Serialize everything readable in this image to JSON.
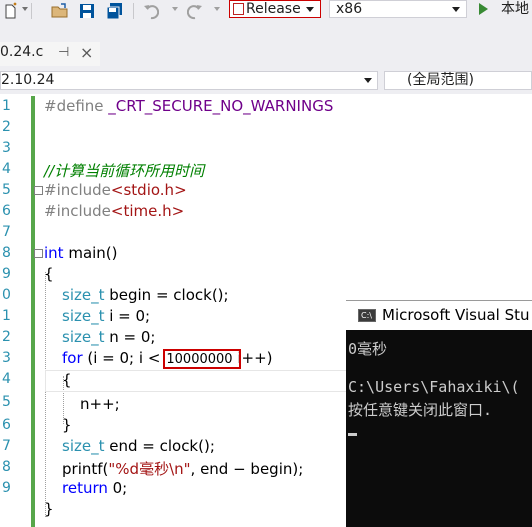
{
  "toolbar": {
    "configuration": "Release",
    "platform": "x86",
    "run_label": "本地"
  },
  "tab": {
    "title": "0.24.c",
    "pin": "⊣",
    "close": "×"
  },
  "navbar": {
    "left_scope": "2.10.24",
    "right_scope": "(全局范围)"
  },
  "editor": {
    "line_numbers": [
      "1",
      "2",
      "3",
      "4",
      "5",
      "6",
      "7",
      "8",
      "9",
      "0",
      "1",
      "2",
      "3",
      "4",
      "5",
      "6",
      "7",
      "8",
      "9"
    ],
    "l1_pp": "#define",
    "l1_macro": " _CRT_SECURE_NO_WARNINGS",
    "l4_comment": "//计算当前循环所用时间",
    "l5_pp": "#include",
    "l5_hdr": "<stdio.h>",
    "l6_pp": "#include",
    "l6_hdr": "<time.h>",
    "l8_kw": "int",
    "l8_rest": " main()",
    "l9": "{",
    "l10_type": "size_t",
    "l10_rest": " begin = clock();",
    "l11_type": "size_t",
    "l11_rest": " i = 0;",
    "l12_type": "size_t",
    "l12_rest": " n = 0;",
    "l13_kw": "for",
    "l13_a": " (i = 0; i <",
    "l13_num": "10000000",
    "l13_b": " i++)",
    "l14": "{",
    "l15": "n++;",
    "l16": "}",
    "l17_type": "size_t",
    "l17_rest": " end = clock();",
    "l18_a": "printf(",
    "l18_str": "\"%d毫秒\\n\"",
    "l18_b": ", end − begin);",
    "l19_kw": "return",
    "l19_rest": " 0;",
    "l20": "}"
  },
  "console": {
    "title": "Microsoft Visual Stu",
    "icon_text": "C:\\",
    "line1": "0毫秒",
    "line2": "C:\\Users\\Fahaxiki\\(",
    "line3": "按任意键关闭此窗口."
  }
}
